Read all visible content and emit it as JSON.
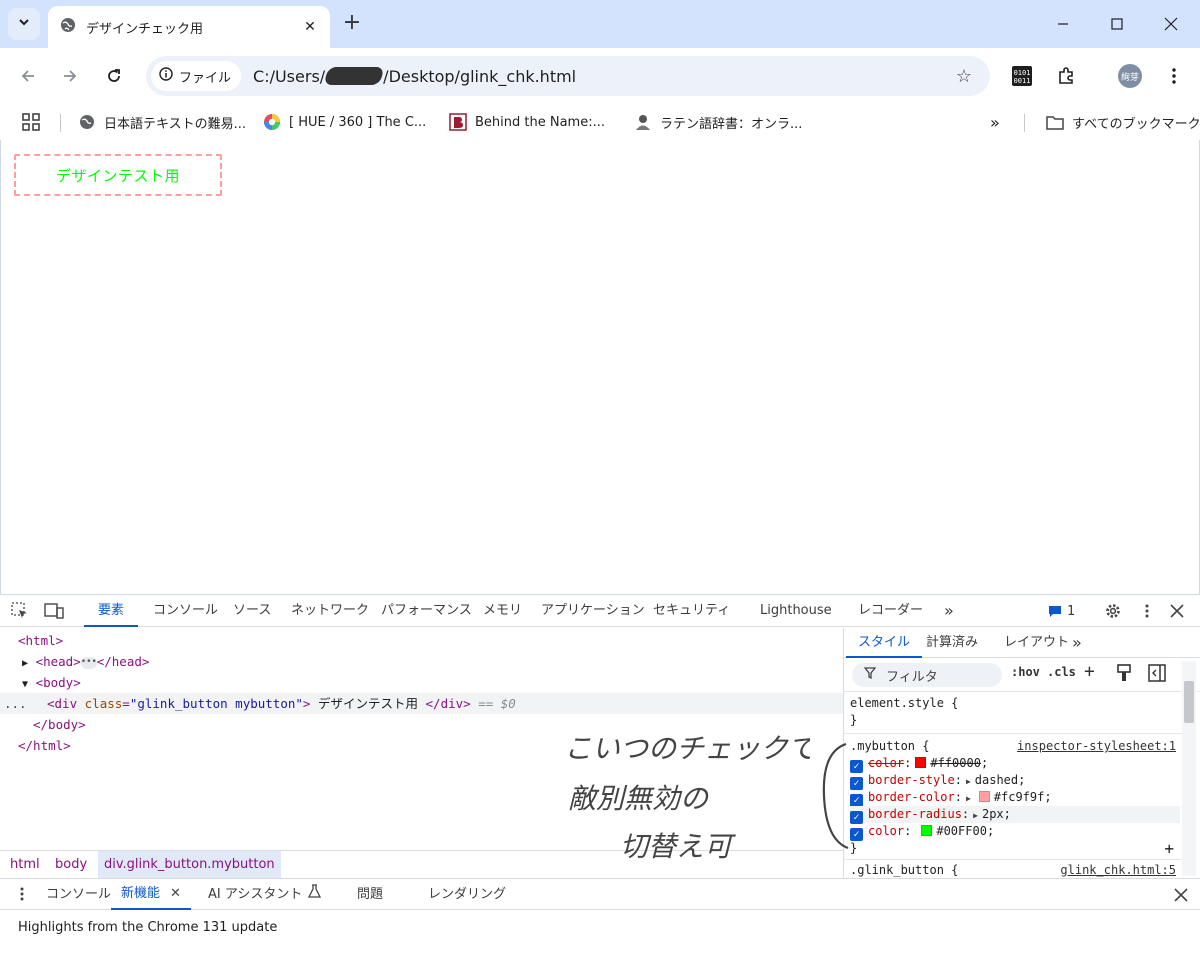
{
  "browser": {
    "tab_title": "デザインチェック用",
    "omnibox": {
      "chip_label": "ファイル",
      "url_prefix": "C:/Users/",
      "url_suffix": "/Desktop/glink_chk.html"
    },
    "avatar_text": "絢芽",
    "bookmarks": [
      {
        "label": "日本語テキストの難易..."
      },
      {
        "label": "[ HUE / 360 ] The C..."
      },
      {
        "label": "Behind the Name:..."
      },
      {
        "label": "ラテン語辞書：オンラ..."
      }
    ],
    "bookmarks_overflow": "»",
    "all_bookmarks": "すべてのブックマーク"
  },
  "page": {
    "button_text": "デザインテスト用"
  },
  "devtools": {
    "tabs": [
      "要素",
      "コンソール",
      "ソース",
      "ネットワーク",
      "パフォーマンス",
      "メモリ",
      "アプリケーション",
      "セキュリティ",
      "Lighthouse",
      "レコーダー"
    ],
    "more": "»",
    "issues_count": "1",
    "dom": {
      "html_open": "<html>",
      "head_open": "<head>",
      "head_close": "</head>",
      "body_open": "<body>",
      "div_open_tag": "<div",
      "div_attr_name": "class",
      "div_attr_value": "\"glink_button mybutton\"",
      "div_text": "デザインテスト用",
      "div_close": "</div>",
      "div_marker": "== $0",
      "body_close": "</body>",
      "html_close": "</html>",
      "row_dots": "..."
    },
    "breadcrumbs": [
      "html",
      "body",
      "div.glink_button.mybutton"
    ],
    "styles": {
      "tabs": [
        "スタイル",
        "計算済み",
        "レイアウト"
      ],
      "more": "»",
      "filter_placeholder": "フィルタ",
      "hov": ":hov",
      "cls": ".cls",
      "element_style": "element.style {",
      "close_brace": "}",
      "rule_selector": ".mybutton {",
      "rule_source": "inspector-stylesheet:1",
      "declarations": [
        {
          "prop": "color",
          "value": "#ff0000",
          "swatch": "#ff0000",
          "struck": true
        },
        {
          "prop": "border-style",
          "value": "dashed",
          "expand": true
        },
        {
          "prop": "border-color",
          "value": "#fc9f9f",
          "swatch": "#fc9f9f",
          "expand": true
        },
        {
          "prop": "border-radius",
          "value": "2px",
          "expand": true
        },
        {
          "prop": "color",
          "value": "#00FF00",
          "swatch": "#00ff00"
        }
      ],
      "next_selector": ".glink_button {",
      "next_source": "glink_chk.html:5",
      "add": "+"
    },
    "drawer": {
      "tabs": [
        "コンソール",
        "新機能",
        "AI アシスタント",
        "問題",
        "レンダリング"
      ],
      "active": "新機能",
      "body_text": "Highlights from the Chrome 131 update"
    }
  },
  "annotation": {
    "line1": "こいつのチェックで",
    "line2": "敵別無効の",
    "line3": "切替え可"
  },
  "colors": {
    "tab_strip": "#d3e3fd",
    "accent": "#0b57d0",
    "button_text": "#00ff00",
    "button_border": "#fc9f9f"
  }
}
